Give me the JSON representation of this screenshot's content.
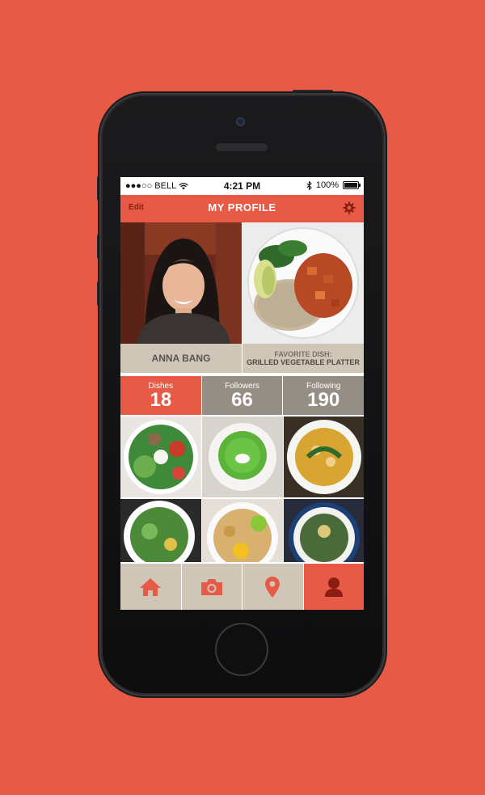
{
  "status_bar": {
    "carrier": "●●●○○ BELL",
    "time": "4:21 PM",
    "battery": "100%"
  },
  "nav": {
    "edit_label": "Edit",
    "title": "MY PROFILE"
  },
  "profile": {
    "name": "ANNA BANG",
    "favorite_label": "FAVORITE DISH:",
    "favorite_dish": "GRILLED VEGETABLE PLATTER"
  },
  "stats": [
    {
      "label": "Dishes",
      "value": "18"
    },
    {
      "label": "Followers",
      "value": "66"
    },
    {
      "label": "Following",
      "value": "190"
    }
  ],
  "tabs": [
    {
      "icon": "home-icon"
    },
    {
      "icon": "camera-icon"
    },
    {
      "icon": "location-pin-icon"
    },
    {
      "icon": "user-icon"
    }
  ],
  "colors": {
    "accent": "#e65a46",
    "caption_bg": "#cfc6b8",
    "stat_gray": "#958e84"
  }
}
